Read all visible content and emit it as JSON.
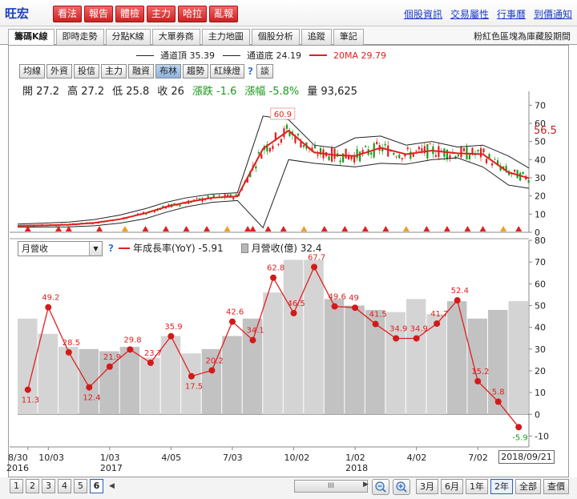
{
  "header": {
    "stock_name": "旺宏",
    "buttons": [
      "看法",
      "報告",
      "體檢",
      "主力",
      "哈拉",
      "亂報"
    ],
    "links": [
      "個股資訊",
      "交易屬性",
      "行事曆",
      "到價通知"
    ]
  },
  "tabs": [
    "籌碼K線",
    "即時走勢",
    "分點K線",
    "大單券商",
    "主力地圖",
    "個股分析",
    "追蹤",
    "筆記"
  ],
  "tab_note": "粉紅色區塊為庫藏股期間",
  "indicators": [
    "均線",
    "外資",
    "投信",
    "主力",
    "融資",
    "布林",
    "趨勢",
    "紅綠燈",
    "?",
    "談"
  ],
  "active_indicator": "布林",
  "quote": {
    "open": "開 27.2",
    "high": "高 27.2",
    "low": "低 25.8",
    "close": "收 26",
    "change": "漲跌 -1.6",
    "pct": "漲幅 -5.8%",
    "volume": "量 93,625"
  },
  "upper_legend": {
    "upper_band": "通道頂 35.39",
    "lower_band": "通道底 24.19",
    "ma": "20MA 29.79"
  },
  "lower_panel": {
    "select_value": "月營收",
    "yoy_label": "年成長率(YoY) -5.91",
    "revenue_label": "月營收(億) 32.4"
  },
  "date_box": "2018/09/21",
  "bottom": {
    "pages": [
      "1",
      "2",
      "3",
      "4",
      "5",
      "6"
    ],
    "active_page": "6",
    "periods": [
      "3月",
      "6月",
      "1年",
      "2年",
      "全部",
      "查價"
    ],
    "active_period": "2年",
    "scroll_grip": "III"
  },
  "colors": {
    "brand": "#1a3cc4",
    "up": "#e02020",
    "down": "#1a9a1a",
    "ma": "#e02020",
    "bar": "#c9c9c9"
  },
  "chart_data": [
    {
      "type": "line",
      "title": "",
      "price_label": "56.5",
      "peak_label": "60.9",
      "ylim": [
        0,
        75
      ],
      "yticks": [
        0,
        10,
        20,
        30,
        40,
        50,
        60,
        70
      ],
      "series": [
        {
          "name": "20MA",
          "x": [
            0,
            5,
            10,
            15,
            20,
            25,
            29,
            33,
            38,
            43,
            48,
            53,
            58,
            62,
            66,
            71,
            76,
            81,
            86,
            91,
            96,
            100
          ],
          "values": [
            3.6,
            3.8,
            4.2,
            5.2,
            7.2,
            10.5,
            14.0,
            16.5,
            19.0,
            19.8,
            46.0,
            56.0,
            44.0,
            42.5,
            42.0,
            46.5,
            43.0,
            45.0,
            43.5,
            43.0,
            33.0,
            29.8
          ]
        },
        {
          "name": "通道頂",
          "x": [
            0,
            5,
            10,
            15,
            20,
            25,
            29,
            33,
            38,
            43,
            48,
            53,
            58,
            62,
            66,
            71,
            76,
            81,
            86,
            91,
            96,
            100
          ],
          "values": [
            4.5,
            5.0,
            5.6,
            7.0,
            9.5,
            13.0,
            16.5,
            19.0,
            21.0,
            21.8,
            64.0,
            62.0,
            48.0,
            46.5,
            52.0,
            53.0,
            48.0,
            50.0,
            47.0,
            48.0,
            42.0,
            35.4
          ]
        },
        {
          "name": "通道底",
          "x": [
            0,
            5,
            10,
            15,
            20,
            25,
            29,
            33,
            38,
            43,
            48,
            53,
            58,
            62,
            66,
            71,
            76,
            81,
            86,
            91,
            96,
            100
          ],
          "values": [
            2.8,
            2.9,
            3.0,
            3.6,
            5.0,
            7.5,
            11.0,
            14.0,
            16.5,
            17.5,
            2.5,
            40.0,
            38.0,
            37.0,
            36.0,
            38.0,
            37.5,
            40.0,
            41.0,
            36.0,
            26.0,
            24.2
          ]
        }
      ]
    },
    {
      "type": "bar",
      "title": "",
      "ylim": [
        -15,
        80
      ],
      "yticks": [
        -10,
        0,
        10,
        20,
        30,
        40,
        50,
        60,
        70,
        80
      ],
      "x_tick_labels": [
        {
          "label": "8/30",
          "sub": "2016",
          "i": 0
        },
        {
          "label": "10/03",
          "sub": "",
          "i": 1
        },
        {
          "label": "1/03",
          "sub": "2017",
          "i": 4
        },
        {
          "label": "4/05",
          "sub": "",
          "i": 7
        },
        {
          "label": "7/03",
          "sub": "",
          "i": 10
        },
        {
          "label": "10/02",
          "sub": "",
          "i": 13
        },
        {
          "label": "1/02",
          "sub": "2018",
          "i": 16
        },
        {
          "label": "4/02",
          "sub": "",
          "i": 19
        },
        {
          "label": "7/02",
          "sub": "",
          "i": 22
        }
      ],
      "series": [
        {
          "name": "月營收(億)",
          "values": [
            44,
            37,
            31,
            30,
            29,
            31,
            26,
            36,
            28,
            30,
            36,
            44,
            56,
            71,
            71,
            53,
            50,
            48,
            47,
            53,
            46,
            52,
            44,
            48,
            52
          ]
        },
        {
          "name": "年成長率(YoY)",
          "values": [
            11.3,
            49.2,
            28.5,
            12.4,
            21.9,
            29.8,
            23.7,
            35.9,
            17.5,
            20.2,
            42.6,
            34.1,
            62.8,
            46.5,
            67.7,
            49.6,
            49,
            41.5,
            34.9,
            34.9,
            41.7,
            52.4,
            15.2,
            5.8,
            -5.9
          ]
        }
      ]
    }
  ]
}
